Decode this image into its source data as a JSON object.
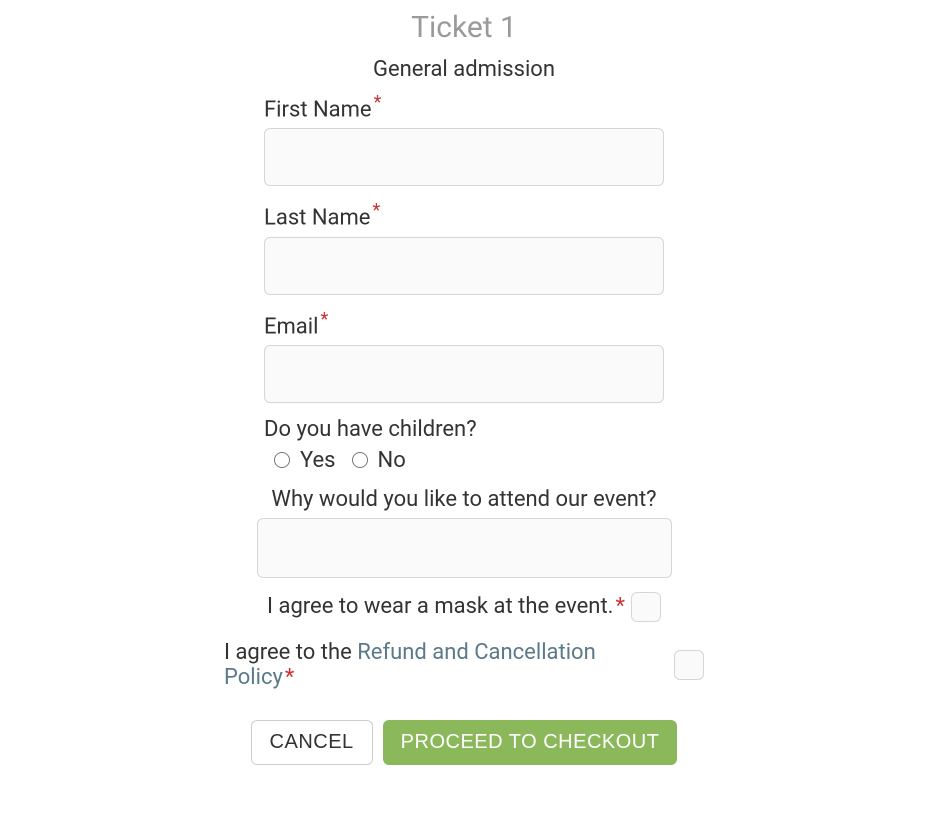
{
  "title": "Ticket 1",
  "subtitle": "General admission",
  "fields": {
    "first_name": {
      "label": "First Name",
      "required": true,
      "value": ""
    },
    "last_name": {
      "label": "Last Name",
      "required": true,
      "value": ""
    },
    "email": {
      "label": "Email",
      "required": true,
      "value": ""
    },
    "children": {
      "label": "Do you have children?",
      "options": {
        "yes": "Yes",
        "no": "No"
      }
    },
    "why_attend": {
      "label": "Why would you like to attend our event?",
      "value": ""
    },
    "mask": {
      "label": "I agree to wear a mask at the event.",
      "required": true
    },
    "policy": {
      "prefix": "I agree to the ",
      "link_text": "Refund and Cancellation Policy",
      "required": true
    }
  },
  "required_marker": "*",
  "buttons": {
    "cancel": "CANCEL",
    "proceed": "PROCEED TO CHECKOUT"
  }
}
